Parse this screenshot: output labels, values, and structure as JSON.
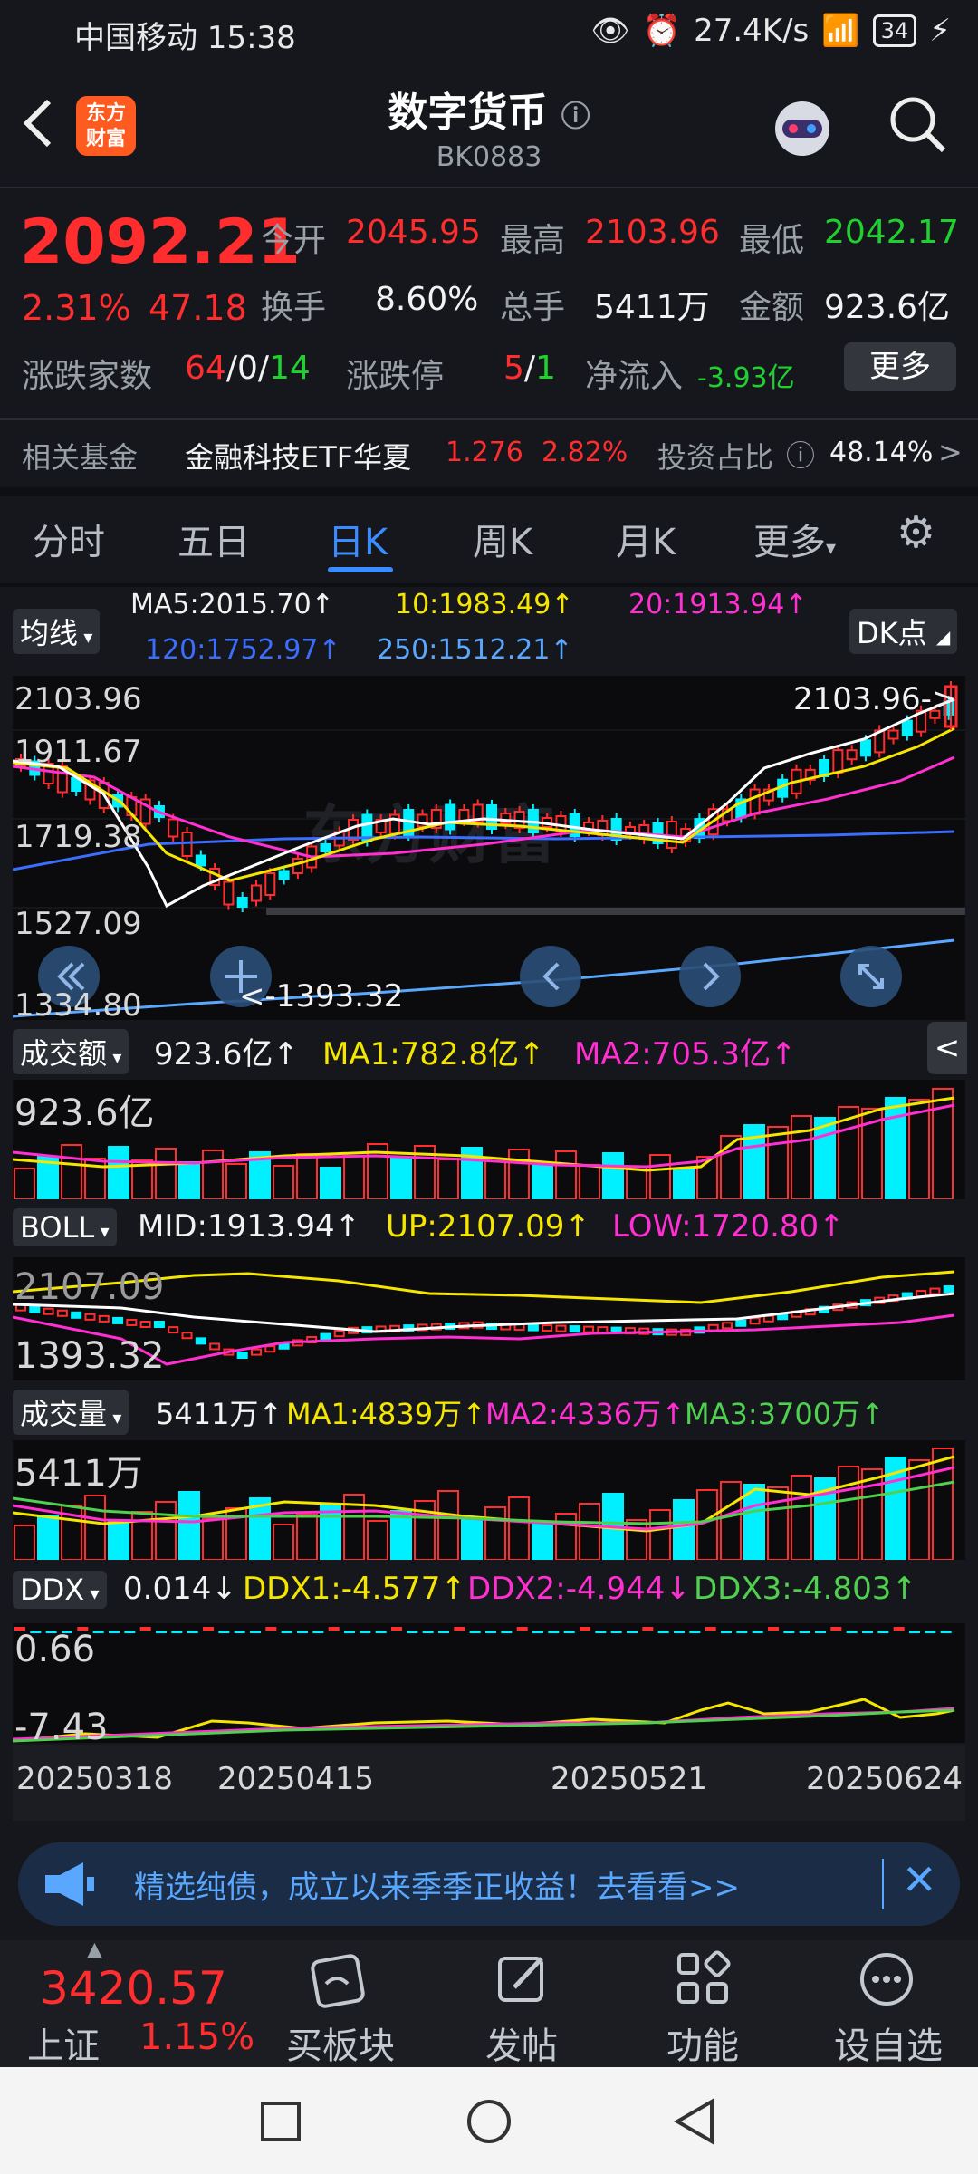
{
  "status": {
    "time": "中国移动 15:38",
    "speed": "27.4K/s",
    "battery": "34"
  },
  "header": {
    "title": "数字货币",
    "code": "BK0883",
    "logo_line1": "东方",
    "logo_line2": "财富"
  },
  "quote": {
    "price": "2092.21",
    "change_pct": "2.31%",
    "change": "47.18",
    "open_label": "今开",
    "open": "2045.95",
    "high_label": "最高",
    "high": "2103.96",
    "low_label": "最低",
    "low": "2042.17",
    "turnover_label": "换手",
    "turnover": "8.60%",
    "vol_label": "总手",
    "vol": "5411万",
    "amount_label": "金额",
    "amount": "923.6亿",
    "updown_label": "涨跌家数",
    "up": "64",
    "flat": "0",
    "down": "14",
    "limit_label": "涨跌停",
    "limit_up": "5",
    "limit_down": "1",
    "inflow_label": "净流入",
    "inflow": "-3.93亿",
    "more": "更多"
  },
  "fund": {
    "label": "相关基金",
    "name": "金融科技ETF华夏",
    "price": "1.276",
    "pct": "2.82%",
    "ratio_label": "投资占比",
    "ratio": "48.14%"
  },
  "tabs": [
    "分时",
    "五日",
    "日K",
    "周K",
    "月K",
    "更多",
    "⚙"
  ],
  "ma": {
    "selector": "均线",
    "ma5": "MA5:2015.70↑",
    "ma10": "10:1983.49↑",
    "ma20": "20:1913.94↑",
    "ma120": "120:1752.97↑",
    "ma250": "250:1512.21↑",
    "dk": "DK点"
  },
  "kaxis": {
    "a": "2103.96",
    "b": "1911.67",
    "c": "1719.38",
    "d": "1527.09",
    "e": "1334.80",
    "hi": "2103.96->",
    "lo": "<-1393.32"
  },
  "amount_ind": {
    "selector": "成交额",
    "val": "923.6亿↑",
    "ma1": "MA1:782.8亿↑",
    "ma2": "MA2:705.3亿↑",
    "axis": "923.6亿"
  },
  "boll": {
    "selector": "BOLL",
    "mid": "MID:1913.94↑",
    "up": "UP:2107.09↑",
    "low": "LOW:1720.80↑",
    "axis_top": "2107.09",
    "axis_bot": "1393.32"
  },
  "volume": {
    "selector": "成交量",
    "val": "5411万↑",
    "ma1": "MA1:4839万↑",
    "ma2": "MA2:4336万↑",
    "ma3": "MA3:3700万↑",
    "axis": "5411万"
  },
  "ddx": {
    "selector": "DDX",
    "val": "0.014↓",
    "ddx1": "DDX1:-4.577↑",
    "ddx2": "DDX2:-4.944↓",
    "ddx3": "DDX3:-4.803↑",
    "axis_top": "0.66",
    "axis_bot": "-7.43"
  },
  "dates": [
    "20250318",
    "20250415",
    "20250521",
    "20250624"
  ],
  "banner": {
    "text": "精选纯债，成立以来季季正收益！去看看>>"
  },
  "bottom": {
    "index_price": "3420.57",
    "index_name": "上证",
    "index_pct": "1.15%",
    "items": [
      "买板块",
      "发帖",
      "功能",
      "设自选"
    ]
  },
  "colors": {
    "red": "#ff2d2d",
    "green": "#1fd12e",
    "cyan": "#00f0ff",
    "yellow": "#f5e600",
    "magenta": "#ff2fd1",
    "accent": "#3b8cff"
  }
}
